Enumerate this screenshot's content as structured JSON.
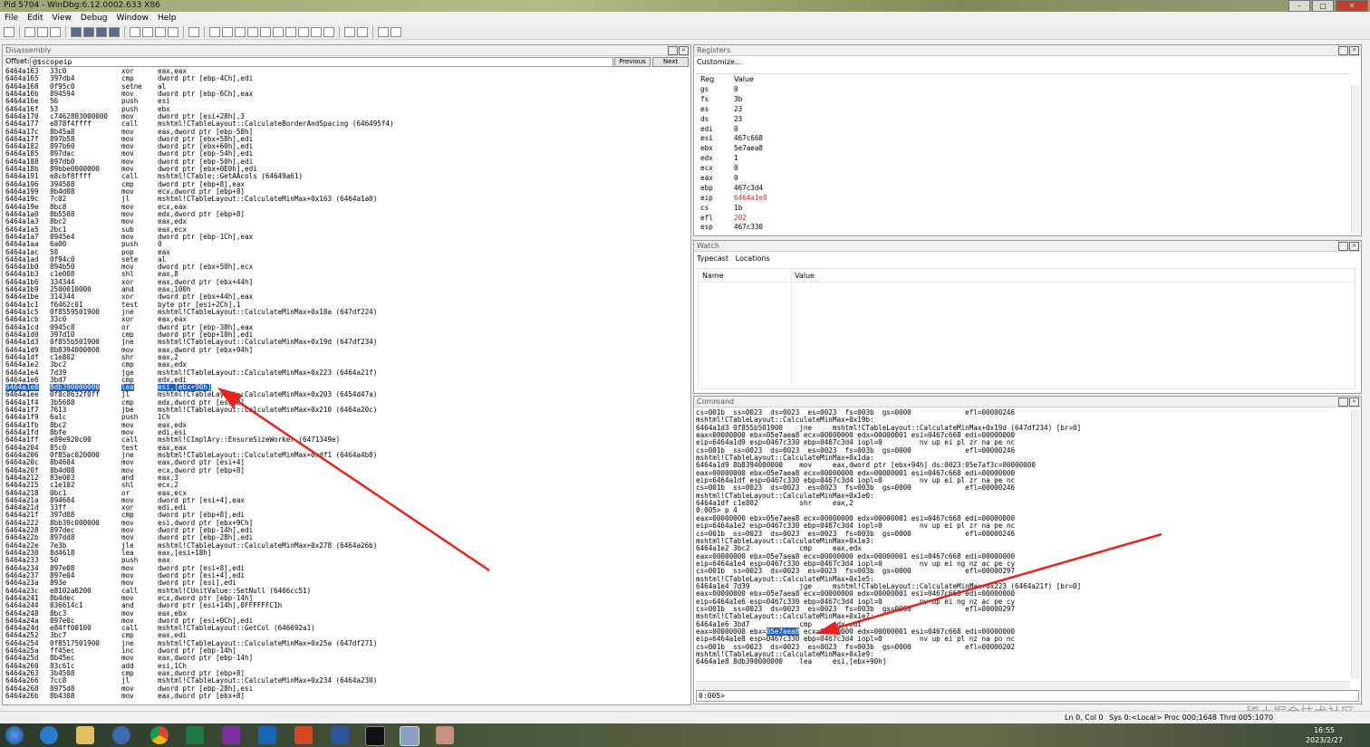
{
  "window": {
    "title": "Pid 5704 - WinDbg:6.12.0002.633 X86"
  },
  "menu": [
    "File",
    "Edit",
    "View",
    "Debug",
    "Window",
    "Help"
  ],
  "disassembly": {
    "title": "Disassembly",
    "offset_label": "Offset:",
    "offset_value": "@$scopeip",
    "prev_label": "Previous",
    "next_label": "Next",
    "lines": [
      [
        "6464a163",
        "33c0",
        "xor",
        "eax,eax"
      ],
      [
        "6464a165",
        "397db4",
        "cmp",
        "dword ptr [ebp-4Ch],edi"
      ],
      [
        "6464a168",
        "0f95c0",
        "setne",
        "al"
      ],
      [
        "6464a16b",
        "894594",
        "mov",
        "dword ptr [ebp-6Ch],eax"
      ],
      [
        "6464a16e",
        "56",
        "push",
        "esi"
      ],
      [
        "6464a16f",
        "53",
        "push",
        "ebx"
      ],
      [
        "6464a170",
        "c7462803000000",
        "mov",
        "dword ptr [esi+28h],3"
      ],
      [
        "6464a177",
        "e878f4ffff",
        "call",
        "mshtml!CTableLayout::CalculateBorderAndSpacing (646495f4)"
      ],
      [
        "6464a17c",
        "8b45a8",
        "mov",
        "eax,dword ptr [ebp-58h]"
      ],
      [
        "6464a17f",
        "897b58",
        "mov",
        "dword ptr [ebx+58h],edi"
      ],
      [
        "6464a182",
        "897b60",
        "mov",
        "dword ptr [ebx+60h],edi"
      ],
      [
        "6464a185",
        "897dac",
        "mov",
        "dword ptr [ebp-54h],edi"
      ],
      [
        "6464a188",
        "897db0",
        "mov",
        "dword ptr [ebp-50h],edi"
      ],
      [
        "6464a18b",
        "89bbe0000000",
        "mov",
        "dword ptr [ebx+0E0h],edi"
      ],
      [
        "6464a191",
        "e8cbf8ffff",
        "call",
        "mshtml!CTable::GetAAcols (64649a61)"
      ],
      [
        "6464a196",
        "394508",
        "cmp",
        "dword ptr [ebp+8],eax"
      ],
      [
        "6464a199",
        "8b4d08",
        "mov",
        "ecx,dword ptr [ebp+8]"
      ],
      [
        "6464a19c",
        "7c02",
        "jl",
        "mshtml!CTableLayout::CalculateMinMax+0x163 (6464a1a0)"
      ],
      [
        "6464a19e",
        "8bc8",
        "mov",
        "ecx,eax"
      ],
      [
        "6464a1a0",
        "8b5508",
        "mov",
        "edx,dword ptr [ebp+8]"
      ],
      [
        "6464a1a3",
        "8bc2",
        "mov",
        "eax,edx"
      ],
      [
        "6464a1a5",
        "2bc1",
        "sub",
        "eax,ecx"
      ],
      [
        "6464a1a7",
        "8945e4",
        "mov",
        "dword ptr [ebp-1Ch],eax"
      ],
      [
        "6464a1aa",
        "6a00",
        "push",
        "0"
      ],
      [
        "6464a1ac",
        "58",
        "pop",
        "eax"
      ],
      [
        "6464a1ad",
        "0f94c0",
        "sete",
        "al"
      ],
      [
        "6464a1b0",
        "894b50",
        "mov",
        "dword ptr [ebx+50h],ecx"
      ],
      [
        "6464a1b3",
        "c1e008",
        "shl",
        "eax,8"
      ],
      [
        "6464a1b6",
        "334344",
        "xor",
        "eax,dword ptr [ebx+44h]"
      ],
      [
        "6464a1b9",
        "2500010000",
        "and",
        "eax,100h"
      ],
      [
        "6464a1be",
        "314344",
        "xor",
        "dword ptr [ebx+44h],eax"
      ],
      [
        "6464a1c1",
        "f6462c01",
        "test",
        "byte ptr [esi+2Ch],1"
      ],
      [
        "6464a1c5",
        "0f8559501900",
        "jne",
        "mshtml!CTableLayout::CalculateMinMax+0x18a (647df224)"
      ],
      [
        "6464a1cb",
        "33c0",
        "xor",
        "eax,eax"
      ],
      [
        "6464a1cd",
        "0945c8",
        "or",
        "dword ptr [ebp-38h],eax"
      ],
      [
        "6464a1d0",
        "397d10",
        "cmp",
        "dword ptr [ebp+10h],edi"
      ],
      [
        "6464a1d3",
        "0f855b501900",
        "jne",
        "mshtml!CTableLayout::CalculateMinMax+0x19d (647df234)"
      ],
      [
        "6464a1d9",
        "8b8394000000",
        "mov",
        "eax,dword ptr [ebx+94h]"
      ],
      [
        "6464a1df",
        "c1e802",
        "shr",
        "eax,2"
      ],
      [
        "6464a1e2",
        "3bc2",
        "cmp",
        "eax,edx"
      ],
      [
        "6464a1e4",
        "7d39",
        "jge",
        "mshtml!CTableLayout::CalculateMinMax+0x223 (6464a21f)"
      ],
      [
        "6464a1e6",
        "3bd7",
        "cmp",
        "edx,edi"
      ],
      [
        "6464a1e8",
        "8db390000000",
        "lea",
        "esi,[ebx+90h]"
      ],
      [
        "6464a1ee",
        "0f8c8632f0ff",
        "jl",
        "mshtml!CTableLayout::CalculateMinMax+0x203 (6454d47a)"
      ],
      [
        "6464a1f4",
        "3b5608",
        "cmp",
        "edx,dword ptr [esi+8]"
      ],
      [
        "6464a1f7",
        "7613",
        "jbe",
        "mshtml!CTableLayout::CalculateMinMax+0x210 (6464a20c)"
      ],
      [
        "6464a1f9",
        "6a1c",
        "push",
        "1Ch"
      ],
      [
        "6464a1fb",
        "8bc2",
        "mov",
        "eax,edx"
      ],
      [
        "6464a1fd",
        "8bfe",
        "mov",
        "edi,esi"
      ],
      [
        "6464a1ff",
        "e89e920c00",
        "call",
        "mshtml!CImplAry::EnsureSizeWorker (6471349e)"
      ],
      [
        "6464a204",
        "85c0",
        "test",
        "eax,eax"
      ],
      [
        "6464a206",
        "0f85ac020000",
        "jne",
        "mshtml!CTableLayout::CalculateMinMax+0xdf1 (6464a4b8)"
      ],
      [
        "6464a20c",
        "8b4604",
        "mov",
        "eax,dword ptr [esi+4]"
      ],
      [
        "6464a20f",
        "8b4d08",
        "mov",
        "ecx,dword ptr [ebp+8]"
      ],
      [
        "6464a212",
        "83e003",
        "and",
        "eax,3"
      ],
      [
        "6464a215",
        "c1e102",
        "shl",
        "ecx,2"
      ],
      [
        "6464a218",
        "0bc1",
        "or",
        "eax,ecx"
      ],
      [
        "6464a21a",
        "894604",
        "mov",
        "dword ptr [esi+4],eax"
      ],
      [
        "6464a21d",
        "33ff",
        "xor",
        "edi,edi"
      ],
      [
        "6464a21f",
        "397d08",
        "cmp",
        "dword ptr [ebp+8],edi"
      ],
      [
        "6464a222",
        "8bb39c000000",
        "mov",
        "esi,dword ptr [ebx+9Ch]"
      ],
      [
        "6464a228",
        "897dec",
        "mov",
        "dword ptr [ebp-14h],edi"
      ],
      [
        "6464a22b",
        "897dd8",
        "mov",
        "dword ptr [ebp-28h],edi"
      ],
      [
        "6464a22e",
        "7e3b",
        "jle",
        "mshtml!CTableLayout::CalculateMinMax+0x278 (6464a26b)"
      ],
      [
        "6464a230",
        "8d4618",
        "lea",
        "eax,[esi+18h]"
      ],
      [
        "6464a233",
        "50",
        "push",
        "eax"
      ],
      [
        "6464a234",
        "897e08",
        "mov",
        "dword ptr [esi+8],edi"
      ],
      [
        "6464a237",
        "897e04",
        "mov",
        "dword ptr [esi+4],edi"
      ],
      [
        "6464a23a",
        "893e",
        "mov",
        "dword ptr [esi],edi"
      ],
      [
        "6464a23c",
        "e8102a0200",
        "call",
        "mshtml!CUnitValue::SetNull (6466cc51)"
      ],
      [
        "6464a241",
        "8b4dec",
        "mov",
        "ecx,dword ptr [ebp-14h]"
      ],
      [
        "6464a244",
        "836614c1",
        "and",
        "dword ptr [esi+14h],0FFFFFFC1h"
      ],
      [
        "6464a248",
        "8bc3",
        "mov",
        "eax,ebx"
      ],
      [
        "6464a24a",
        "897e0c",
        "mov",
        "dword ptr [esi+0Ch],edi"
      ],
      [
        "6464a24d",
        "e84ff00100",
        "call",
        "mshtml!CTableLayout::GetCol (646692a1)"
      ],
      [
        "6464a252",
        "3bc7",
        "cmp",
        "eax,edi"
      ],
      [
        "6464a254",
        "0f8517501900",
        "jne",
        "mshtml!CTableLayout::CalculateMinMax+0x25a (647df271)"
      ],
      [
        "6464a25a",
        "ff45ec",
        "inc",
        "dword ptr [ebp-14h]"
      ],
      [
        "6464a25d",
        "8b45ec",
        "mov",
        "eax,dword ptr [ebp-14h]"
      ],
      [
        "6464a260",
        "83c61c",
        "add",
        "esi,1Ch"
      ],
      [
        "6464a263",
        "3b4508",
        "cmp",
        "eax,dword ptr [ebp+8]"
      ],
      [
        "6464a266",
        "7cc8",
        "jl",
        "mshtml!CTableLayout::CalculateMinMax+0x234 (6464a230)"
      ],
      [
        "6464a268",
        "8975d8",
        "mov",
        "dword ptr [ebp-28h],esi"
      ],
      [
        "6464a26b",
        "8b4308",
        "mov",
        "eax,dword ptr [ebx+8]"
      ]
    ],
    "highlight_index": 42
  },
  "registers": {
    "title": "Registers",
    "customize": "Customize...",
    "col_reg": "Reg",
    "col_value": "Value",
    "changed_color": "#e02020",
    "rows": [
      {
        "name": "gs",
        "value": "0"
      },
      {
        "name": "fs",
        "value": "3b"
      },
      {
        "name": "es",
        "value": "23"
      },
      {
        "name": "ds",
        "value": "23"
      },
      {
        "name": "edi",
        "value": "0"
      },
      {
        "name": "esi",
        "value": "467c668"
      },
      {
        "name": "ebx",
        "value": "5e7aea8"
      },
      {
        "name": "edx",
        "value": "1"
      },
      {
        "name": "ecx",
        "value": "0"
      },
      {
        "name": "eax",
        "value": "0"
      },
      {
        "name": "ebp",
        "value": "467c3d4"
      },
      {
        "name": "eip",
        "value": "6464a1e8",
        "changed": true
      },
      {
        "name": "cs",
        "value": "1b"
      },
      {
        "name": "efl",
        "value": "202",
        "changed": true
      },
      {
        "name": "esp",
        "value": "467c330"
      }
    ]
  },
  "watch": {
    "title": "Watch",
    "tab_typecast": "Typecast",
    "tab_locations": "Locations",
    "col_name": "Name",
    "col_value": "Value"
  },
  "command": {
    "title": "Command",
    "lines": [
      "cs=001b  ss=0023  ds=0023  es=0023  fs=003b  gs=0000             efl=00000246",
      "mshtml!CTableLayout::CalculateMinMax+0x19b:",
      "6464a1d3 0f855b501900    jne     mshtml!CTableLayout::CalculateMinMax+0x19d (647df234) [br=0]",
      "eax=00000000 ebx=05e7aea8 ecx=00000000 edx=00000001 esi=0467c668 edi=00000000",
      "eip=6464a1d9 esp=0467c330 ebp=0467c3d4 iopl=0         nv up ei pl zr na pe nc",
      "cs=001b  ss=0023  ds=0023  es=0023  fs=003b  gs=0000             efl=00000246",
      "mshtml!CTableLayout::CalculateMinMax+0x1da:",
      "6464a1d9 8b8394000000    mov     eax,dword ptr [ebx+94h] ds:0023:05e7af3c=00000000",
      "eax=00000000 ebx=05e7aea8 ecx=00000000 edx=00000001 esi=0467c668 edi=00000000",
      "eip=6464a1df esp=0467c330 ebp=0467c3d4 iopl=0         nv up ei pl zr na pe nc",
      "cs=001b  ss=0023  ds=0023  es=0023  fs=003b  gs=0000             efl=00000246",
      "mshtml!CTableLayout::CalculateMinMax+0x1e0:",
      "6464a1df c1e802          shr     eax,2",
      "0:005> p 4",
      "eax=00000000 ebx=05e7aea8 ecx=00000000 edx=00000001 esi=0467c668 edi=00000000",
      "eip=6464a1e2 esp=0467c330 ebp=0467c3d4 iopl=0         nv up ei pl zr na pe nc",
      "cs=001b  ss=0023  ds=0023  es=0023  fs=003b  gs=0000             efl=00000246",
      "mshtml!CTableLayout::CalculateMinMax+0x1e3:",
      "6464a1e2 3bc2            cmp     eax,edx",
      "eax=00000000 ebx=05e7aea8 ecx=00000000 edx=00000001 esi=0467c668 edi=00000000",
      "eip=6464a1e4 esp=0467c330 ebp=0467c3d4 iopl=0         nv up ei ng nz ac pe cy",
      "cs=001b  ss=0023  ds=0023  es=0023  fs=003b  gs=0000             efl=00000297",
      "mshtml!CTableLayout::CalculateMinMax+0x1e5:",
      "6464a1e4 7d39            jge     mshtml!CTableLayout::CalculateMinMax+0x223 (6464a21f) [br=0]",
      "eax=00000000 ebx=05e7aea8 ecx=00000000 edx=00000001 esi=0467c668 edi=00000000",
      "eip=6464a1e6 esp=0467c330 ebp=0467c3d4 iopl=0         nv up ei ng nz ac pe cy",
      "cs=001b  ss=0023  ds=0023  es=0023  fs=003b  gs=0000             efl=00000297",
      "mshtml!CTableLayout::CalculateMinMax+0x1e7:",
      "6464a1e6 3bd7            cmp     edx,edi",
      "eax=00000000 ebx=05e7aea8 ecx=00000000 edx=00000001 esi=0467c668 edi=00000000",
      "eip=6464a1e8 esp=0467c330 ebp=0467c3d4 iopl=0         nv up ei pl nz na po nc",
      "cs=001b  ss=0023  ds=0023  es=0023  fs=003b  gs=0000             efl=00000202",
      "mshtml!CTableLayout::CalculateMinMax+0x1e9:",
      "6464a1e8 8db390000000    lea     esi,[ebx+90h]"
    ],
    "highlight_line": 29,
    "highlight_text": "05e7aea8",
    "prompt": "0:005>"
  },
  "status": {
    "pos": "Ln 0, Col 0",
    "sys": "Sys 0:<Local>",
    "proc": "Proc 000:1648",
    "thrd": "Thrd 005:1070"
  },
  "clock": {
    "time": "16:55",
    "date": "2023/2/27"
  },
  "watermark": "稀土掘金技术社区",
  "colors": {
    "highlight": "#1e5fc8",
    "arrow": "#e8231c"
  }
}
